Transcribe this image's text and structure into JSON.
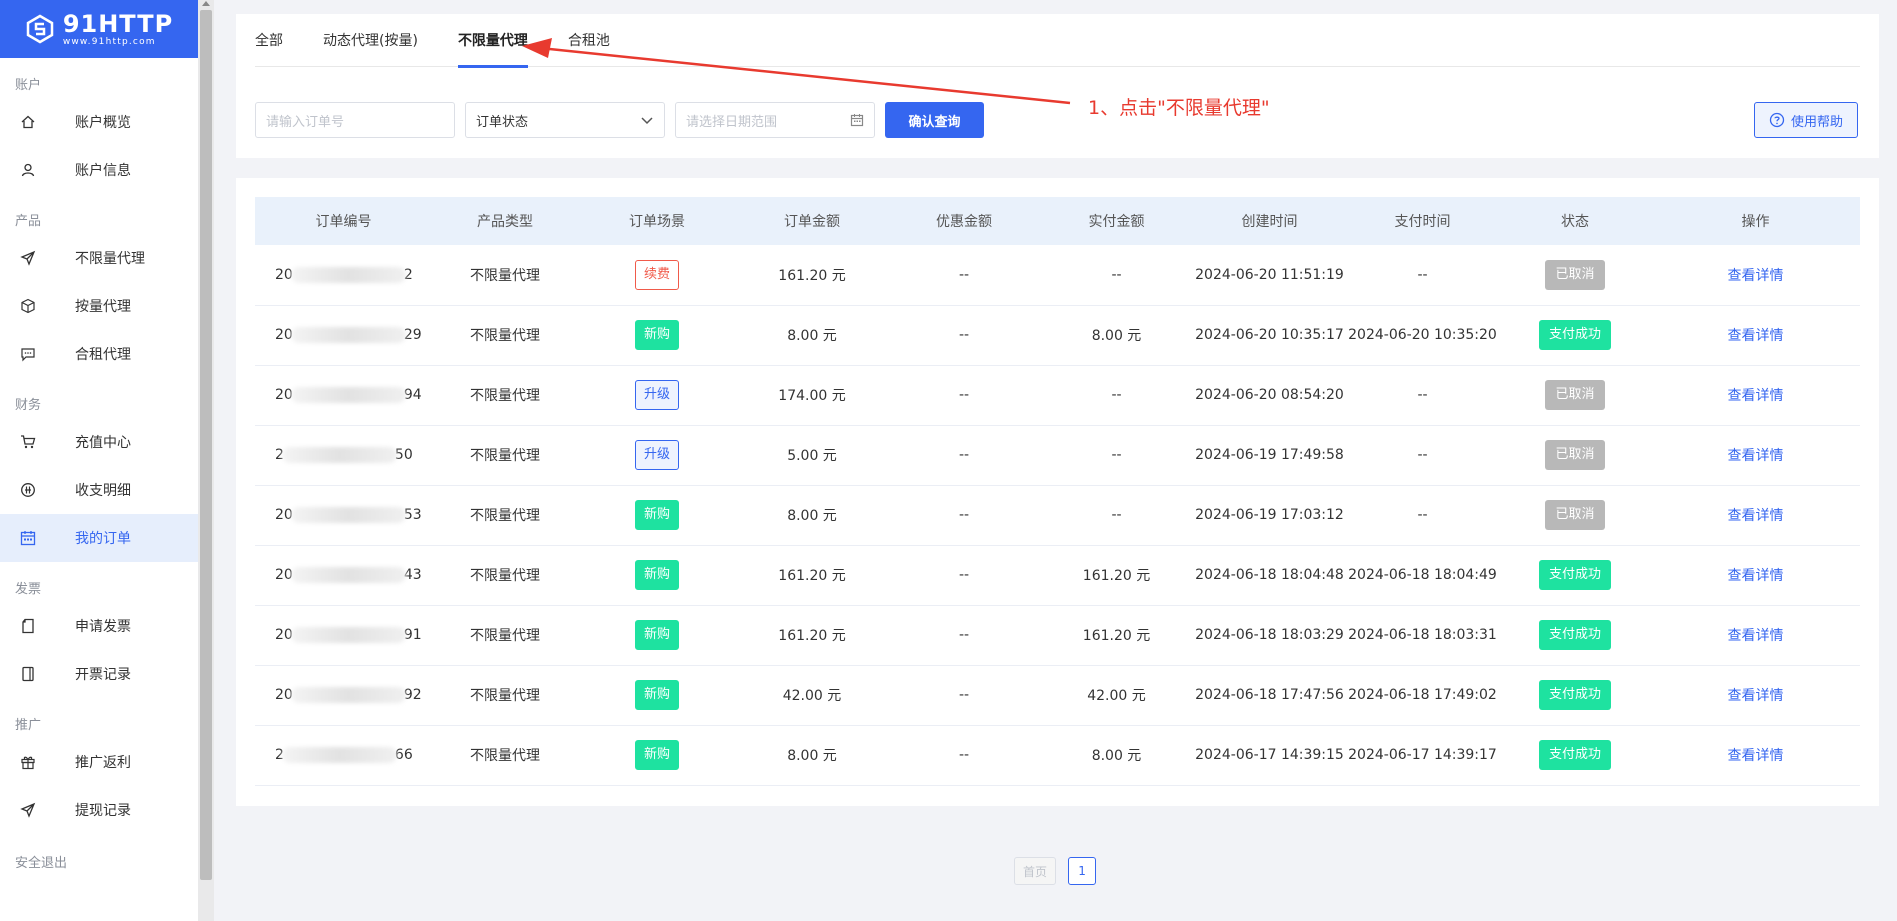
{
  "logo": {
    "main": "91HTTP",
    "sub": "www.91http.com"
  },
  "sidebar": {
    "sections": [
      {
        "title": "账户",
        "items": [
          {
            "label": "账户概览",
            "icon": "home-icon"
          },
          {
            "label": "账户信息",
            "icon": "user-icon"
          }
        ]
      },
      {
        "title": "产品",
        "items": [
          {
            "label": "不限量代理",
            "icon": "send-icon"
          },
          {
            "label": "按量代理",
            "icon": "box-icon"
          },
          {
            "label": "合租代理",
            "icon": "chat-icon"
          }
        ]
      },
      {
        "title": "财务",
        "items": [
          {
            "label": "充值中心",
            "icon": "cart-icon"
          },
          {
            "label": "收支明细",
            "icon": "coin-icon"
          },
          {
            "label": "我的订单",
            "icon": "calendar-icon",
            "active": true
          }
        ]
      },
      {
        "title": "发票",
        "items": [
          {
            "label": "申请发票",
            "icon": "document-icon"
          },
          {
            "label": "开票记录",
            "icon": "record-icon"
          }
        ]
      },
      {
        "title": "推广",
        "items": [
          {
            "label": "推广返利",
            "icon": "gift-icon"
          },
          {
            "label": "提现记录",
            "icon": "send-icon"
          }
        ]
      }
    ],
    "logout": "安全退出"
  },
  "tabs": [
    "全部",
    "动态代理(按量)",
    "不限量代理",
    "合租池"
  ],
  "active_tab": 2,
  "filters": {
    "order_placeholder": "请输入订单号",
    "status_select": "订单状态",
    "date_placeholder": "请选择日期范围",
    "search_button": "确认查询",
    "help_button": "使用帮助"
  },
  "annotation": "1、点击\"不限量代理\"",
  "table": {
    "headers": [
      "订单编号",
      "产品类型",
      "订单场景",
      "订单金额",
      "优惠金额",
      "实付金额",
      "创建时间",
      "支付时间",
      "状态",
      "操作"
    ],
    "rows": [
      {
        "id_start": "20",
        "id_end": "2",
        "product": "不限量代理",
        "scene": "续费",
        "scene_type": "renew",
        "amount": "161.20 元",
        "discount": "--",
        "paid": "--",
        "created": "2024-06-20 11:51:19",
        "pay_time": "--",
        "status": "已取消",
        "status_type": "cancel",
        "action": "查看详情"
      },
      {
        "id_start": "20",
        "id_end": "29",
        "product": "不限量代理",
        "scene": "新购",
        "scene_type": "new",
        "amount": "8.00 元",
        "discount": "--",
        "paid": "8.00 元",
        "created": "2024-06-20 10:35:17",
        "pay_time": "2024-06-20 10:35:20",
        "status": "支付成功",
        "status_type": "paid",
        "action": "查看详情"
      },
      {
        "id_start": "20",
        "id_end": "94",
        "product": "不限量代理",
        "scene": "升级",
        "scene_type": "upgrade",
        "amount": "174.00 元",
        "discount": "--",
        "paid": "--",
        "created": "2024-06-20 08:54:20",
        "pay_time": "--",
        "status": "已取消",
        "status_type": "cancel",
        "action": "查看详情"
      },
      {
        "id_start": "2",
        "id_end": "50",
        "product": "不限量代理",
        "scene": "升级",
        "scene_type": "upgrade",
        "amount": "5.00 元",
        "discount": "--",
        "paid": "--",
        "created": "2024-06-19 17:49:58",
        "pay_time": "--",
        "status": "已取消",
        "status_type": "cancel",
        "action": "查看详情"
      },
      {
        "id_start": "20",
        "id_end": "53",
        "product": "不限量代理",
        "scene": "新购",
        "scene_type": "new",
        "amount": "8.00 元",
        "discount": "--",
        "paid": "--",
        "created": "2024-06-19 17:03:12",
        "pay_time": "--",
        "status": "已取消",
        "status_type": "cancel",
        "action": "查看详情"
      },
      {
        "id_start": "20",
        "id_end": "43",
        "product": "不限量代理",
        "scene": "新购",
        "scene_type": "new",
        "amount": "161.20 元",
        "discount": "--",
        "paid": "161.20 元",
        "created": "2024-06-18 18:04:48",
        "pay_time": "2024-06-18 18:04:49",
        "status": "支付成功",
        "status_type": "paid",
        "action": "查看详情"
      },
      {
        "id_start": "20",
        "id_end": "91",
        "product": "不限量代理",
        "scene": "新购",
        "scene_type": "new",
        "amount": "161.20 元",
        "discount": "--",
        "paid": "161.20 元",
        "created": "2024-06-18 18:03:29",
        "pay_time": "2024-06-18 18:03:31",
        "status": "支付成功",
        "status_type": "paid",
        "action": "查看详情"
      },
      {
        "id_start": "20",
        "id_end": "92",
        "product": "不限量代理",
        "scene": "新购",
        "scene_type": "new",
        "amount": "42.00 元",
        "discount": "--",
        "paid": "42.00 元",
        "created": "2024-06-18 17:47:56",
        "pay_time": "2024-06-18 17:49:02",
        "status": "支付成功",
        "status_type": "paid",
        "action": "查看详情"
      },
      {
        "id_start": "2",
        "id_end": "66",
        "product": "不限量代理",
        "scene": "新购",
        "scene_type": "new",
        "amount": "8.00 元",
        "discount": "--",
        "paid": "8.00 元",
        "created": "2024-06-17 14:39:15",
        "pay_time": "2024-06-17 14:39:17",
        "status": "支付成功",
        "status_type": "paid",
        "action": "查看详情"
      }
    ]
  },
  "pagination": {
    "first": "首页",
    "current": "1"
  },
  "colors": {
    "primary": "#3566f0",
    "success": "#1ee2a0",
    "cancel": "#b8b8b8",
    "annotation": "#e83a2f"
  }
}
